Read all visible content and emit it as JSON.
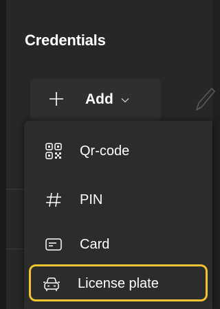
{
  "header": {
    "title": "Credentials"
  },
  "toolbar": {
    "add_label": "Add"
  },
  "menu": {
    "items": [
      {
        "label": "Qr-code",
        "icon": "qr-code-icon"
      },
      {
        "label": "PIN",
        "icon": "hash-icon"
      },
      {
        "label": "Card",
        "icon": "card-icon"
      },
      {
        "label": "License plate",
        "icon": "car-icon"
      }
    ],
    "highlighted_item": "License plate"
  },
  "colors": {
    "background": "#202020",
    "panel": "#272727",
    "button": "#2f2f2f",
    "menu": "#2c2c2c",
    "highlight_border": "#f4c430",
    "text": "#ffffff"
  }
}
